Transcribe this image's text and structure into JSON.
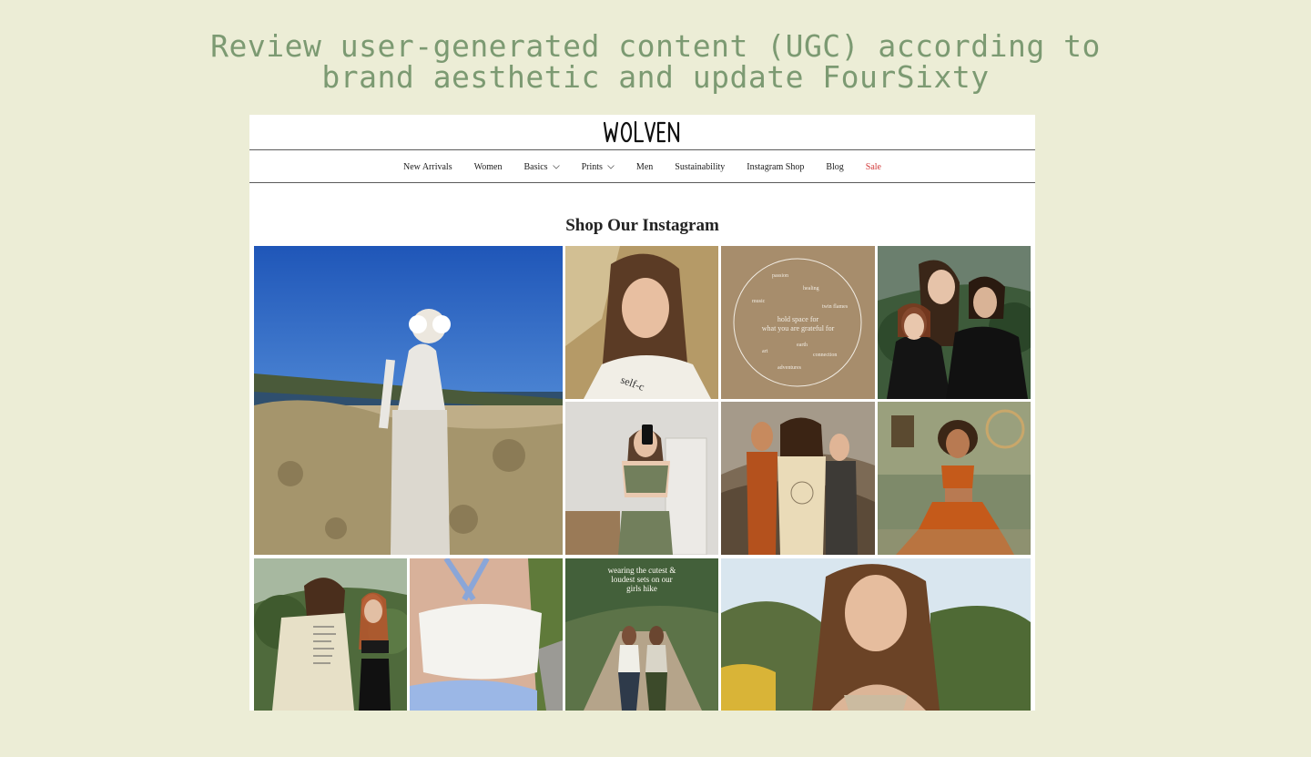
{
  "headline": {
    "line1": "Review user-generated content (UGC) according to",
    "line2": "brand aesthetic and update FourSixty"
  },
  "store": {
    "brand": "WOLVEN",
    "nav": [
      {
        "label": "New Arrivals",
        "dropdown": false
      },
      {
        "label": "Women",
        "dropdown": false
      },
      {
        "label": "Basics",
        "dropdown": true
      },
      {
        "label": "Prints",
        "dropdown": true
      },
      {
        "label": "Men",
        "dropdown": false
      },
      {
        "label": "Sustainability",
        "dropdown": false
      },
      {
        "label": "Instagram Shop",
        "dropdown": false
      },
      {
        "label": "Blog",
        "dropdown": false
      },
      {
        "label": "Sale",
        "dropdown": false
      }
    ],
    "section_title": "Shop Our Instagram",
    "gratitude_post": {
      "words": [
        "passion",
        "healing",
        "music",
        "twin flames",
        "earth",
        "art",
        "connection",
        "adventures"
      ],
      "main_line1": "hold space for",
      "main_line2": "what you are grateful for"
    },
    "hike_post": {
      "line1": "wearing the cutest &",
      "line2": "loudest sets on our",
      "line3": "girls hike"
    }
  },
  "colors": {
    "background": "#ecedd6",
    "headline": "#7c9a72",
    "sale": "#d23a3a"
  }
}
